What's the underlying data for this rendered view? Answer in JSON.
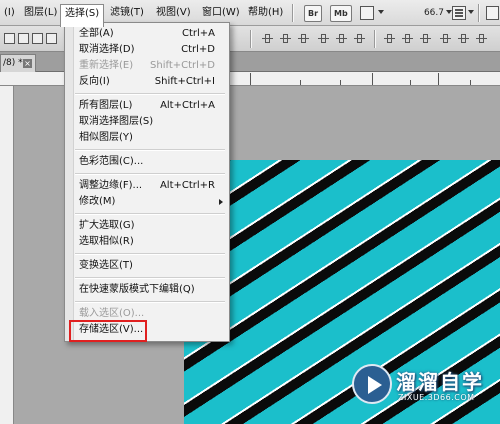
{
  "menubar": {
    "items": [
      {
        "label": "(I)",
        "active": false
      },
      {
        "label": "图层(L)",
        "active": false
      },
      {
        "label": "选择(S)",
        "active": true
      },
      {
        "label": "滤镜(T)",
        "active": false
      },
      {
        "label": "视图(V)",
        "active": false
      },
      {
        "label": "窗口(W)",
        "active": false
      },
      {
        "label": "帮助(H)",
        "active": false
      }
    ],
    "bridge_button": "Br",
    "minibridge_button": "Mb",
    "zoom_value": "66.7"
  },
  "document_tab": {
    "label": "/8) *",
    "close_glyph": "×"
  },
  "select_menu": {
    "items": [
      {
        "label": "全部(A)",
        "shortcut": "Ctrl+A",
        "disabled": false
      },
      {
        "label": "取消选择(D)",
        "shortcut": "Ctrl+D",
        "disabled": false
      },
      {
        "label": "重新选择(E)",
        "shortcut": "Shift+Ctrl+D",
        "disabled": true
      },
      {
        "label": "反向(I)",
        "shortcut": "Shift+Ctrl+I",
        "disabled": false
      },
      {
        "label": "所有图层(L)",
        "shortcut": "Alt+Ctrl+A",
        "disabled": false
      },
      {
        "label": "取消选择图层(S)",
        "shortcut": "",
        "disabled": false
      },
      {
        "label": "相似图层(Y)",
        "shortcut": "",
        "disabled": false
      },
      {
        "label": "色彩范围(C)...",
        "shortcut": "",
        "disabled": false
      },
      {
        "label": "调整边缘(F)...",
        "shortcut": "Alt+Ctrl+R",
        "disabled": false
      },
      {
        "label": "修改(M)",
        "shortcut": "",
        "disabled": false,
        "submenu": true
      },
      {
        "label": "扩大选取(G)",
        "shortcut": "",
        "disabled": false
      },
      {
        "label": "选取相似(R)",
        "shortcut": "",
        "disabled": false
      },
      {
        "label": "变换选区(T)",
        "shortcut": "",
        "disabled": false
      },
      {
        "label": "在快速蒙版模式下编辑(Q)",
        "shortcut": "",
        "disabled": false
      },
      {
        "label": "载入选区(O)...",
        "shortcut": "",
        "disabled": true
      },
      {
        "label": "存储选区(V)...",
        "shortcut": "",
        "disabled": false,
        "highlighted": true
      }
    ]
  },
  "watermark": {
    "name": "溜溜自学",
    "url": "ZIXUE.3D66.COM"
  },
  "colors": {
    "highlight_box": "#e02020",
    "canvas_cyan": "#1bbfcb",
    "canvas_black": "#0a0a0a"
  }
}
